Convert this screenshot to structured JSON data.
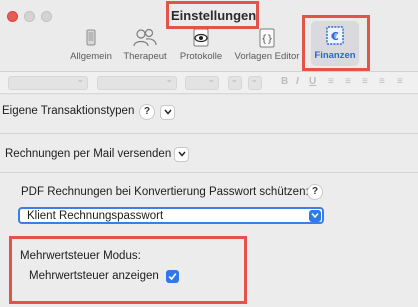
{
  "window": {
    "title": "Einstellungen"
  },
  "toolbar": {
    "tabs": [
      {
        "label": "Allgemein",
        "icon": "phone-icon"
      },
      {
        "label": "Therapeut",
        "icon": "people-icon"
      },
      {
        "label": "Protokolle",
        "icon": "eye-icon"
      },
      {
        "label": "Vorlagen Editor",
        "icon": "braces-document-icon"
      },
      {
        "label": "Finanzen",
        "icon": "euro-stamp-icon",
        "selected": true
      }
    ]
  },
  "content": {
    "transaction_types": {
      "label": "Eigene Transaktionstypen",
      "help": "?"
    },
    "mail_invoices": {
      "label": "Rechnungen per Mail versenden"
    },
    "pdf_password": {
      "label": "PDF Rechnungen bei Konvertierung Passwort schützen:",
      "help": "?",
      "selected_value": "Klient Rechnungspasswort"
    },
    "vat": {
      "section_label": "Mehrwertsteuer Modus:",
      "checkbox_label": "Mehrwertsteuer anzeigen",
      "checked": true
    }
  },
  "colors": {
    "highlight": "#e2534a",
    "accent": "#2f78ea"
  }
}
